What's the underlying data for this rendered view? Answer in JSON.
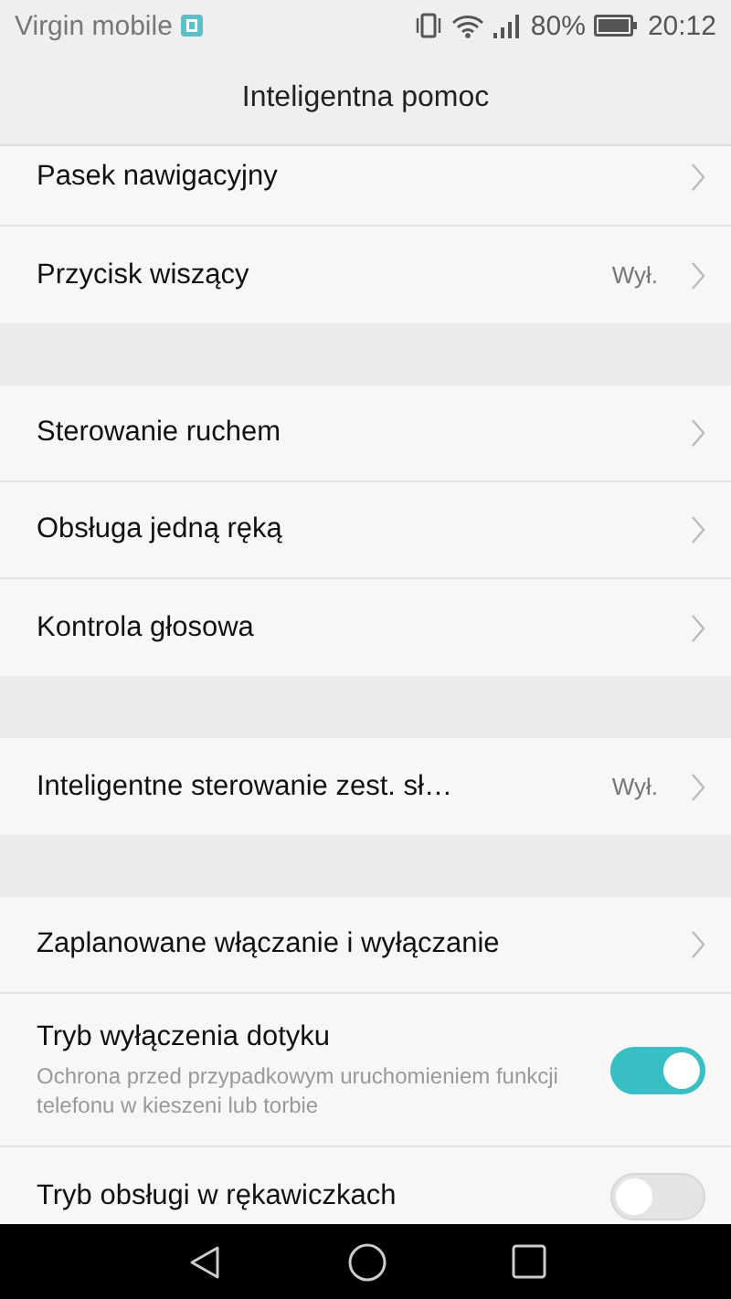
{
  "status_bar": {
    "carrier": "Virgin mobile",
    "battery": "80%",
    "time": "20:12"
  },
  "title": "Inteligentna pomoc",
  "groups": [
    {
      "items": [
        {
          "kind": "nav",
          "label": "Pasek nawigacyjny"
        },
        {
          "kind": "nav",
          "label": "Przycisk wiszący",
          "value": "Wył."
        }
      ]
    },
    {
      "items": [
        {
          "kind": "nav",
          "label": "Sterowanie ruchem"
        },
        {
          "kind": "nav",
          "label": "Obsługa jedną ręką"
        },
        {
          "kind": "nav",
          "label": "Kontrola głosowa"
        }
      ]
    },
    {
      "items": [
        {
          "kind": "nav",
          "label": "Inteligentne sterowanie zest. sł…",
          "value": "Wył."
        }
      ]
    },
    {
      "items": [
        {
          "kind": "nav",
          "label": "Zaplanowane włączanie i wyłączanie"
        },
        {
          "kind": "toggle",
          "label": "Tryb wyłączenia dotyku",
          "description": "Ochrona przed przypadkowym uruchomieniem funkcji telefonu w kieszeni lub torbie",
          "on": true
        },
        {
          "kind": "toggle",
          "label": "Tryb obsługi w rękawiczkach",
          "on": false
        }
      ]
    }
  ]
}
